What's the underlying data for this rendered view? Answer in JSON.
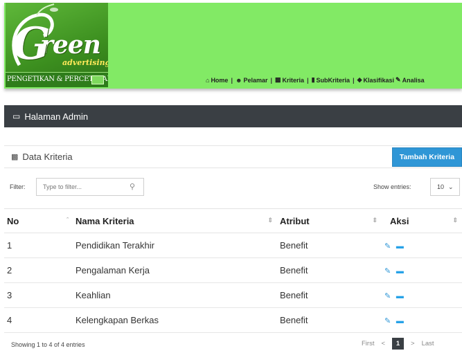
{
  "logo": {
    "word": "reen",
    "letter": "G",
    "sub": "advertising",
    "strip": "PENGETIKAN & PERCETAKAN"
  },
  "nav": {
    "home": "Home",
    "pelamar": "Pelamar",
    "kriteria": "Kriteria",
    "subkriteria": "SubKriteria",
    "klasifikasi": "Klasifikasi",
    "analisa": "Analisa",
    "separator": "|"
  },
  "admin_bar": {
    "title": "Halaman Admin"
  },
  "panel": {
    "title": "Data Kriteria",
    "add_button": "Tambah Kriteria"
  },
  "filter": {
    "label": "Filter:",
    "placeholder": "Type to filter...",
    "entries_label": "Show entries:",
    "entries_value": "10"
  },
  "table": {
    "headers": [
      "No",
      "Nama Kriteria",
      "Atribut",
      "Aksi"
    ],
    "rows": [
      {
        "no": "1",
        "nama": "Pendidikan Terakhir",
        "atribut": "Benefit"
      },
      {
        "no": "2",
        "nama": "Pengalaman Kerja",
        "atribut": "Benefit"
      },
      {
        "no": "3",
        "nama": "Keahlian",
        "atribut": "Benefit"
      },
      {
        "no": "4",
        "nama": "Kelengkapan Berkas",
        "atribut": "Benefit"
      }
    ]
  },
  "footer": {
    "info": "Showing 1 to 4 of 4 entries",
    "first": "First",
    "prev": "<",
    "current_page": "1",
    "next": ">",
    "last": "Last"
  },
  "colors": {
    "header_green": "#82ea65",
    "dark_bar": "#3a3f44",
    "accent_blue": "#2f96d6"
  }
}
